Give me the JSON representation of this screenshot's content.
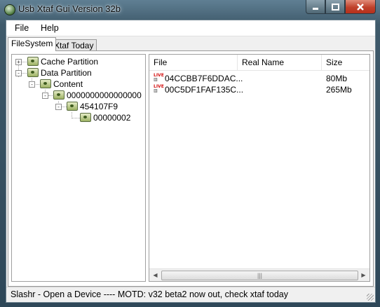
{
  "window": {
    "title": "Usb Xtaf Gui Version 32b"
  },
  "menu": {
    "items": [
      "File",
      "Help"
    ]
  },
  "tabs": [
    "FileSystem",
    "Xtaf Today"
  ],
  "tree": {
    "nodes": [
      {
        "label": "Cache Partition",
        "expander": "+"
      },
      {
        "label": "Data Partition",
        "expander": "-"
      },
      {
        "label": "Content",
        "expander": "-"
      },
      {
        "label": "0000000000000000",
        "expander": "-"
      },
      {
        "label": "454107F9",
        "expander": "-"
      },
      {
        "label": "00000002",
        "expander": ""
      }
    ]
  },
  "list": {
    "columns": [
      "File",
      "Real Name",
      "Size"
    ],
    "rows": [
      {
        "file": "04CCBB7F6DDAC...",
        "real_name": "",
        "size": "80Mb",
        "icon": "live-icon"
      },
      {
        "file": "00C5DF1FAF135C...",
        "real_name": "",
        "size": "265Mb",
        "icon": "live-icon"
      }
    ],
    "icon_text": "LIVE"
  },
  "status": {
    "text": "Slashr - Open a Device ---- MOTD: v32 beta2 now out, check xtaf today"
  }
}
